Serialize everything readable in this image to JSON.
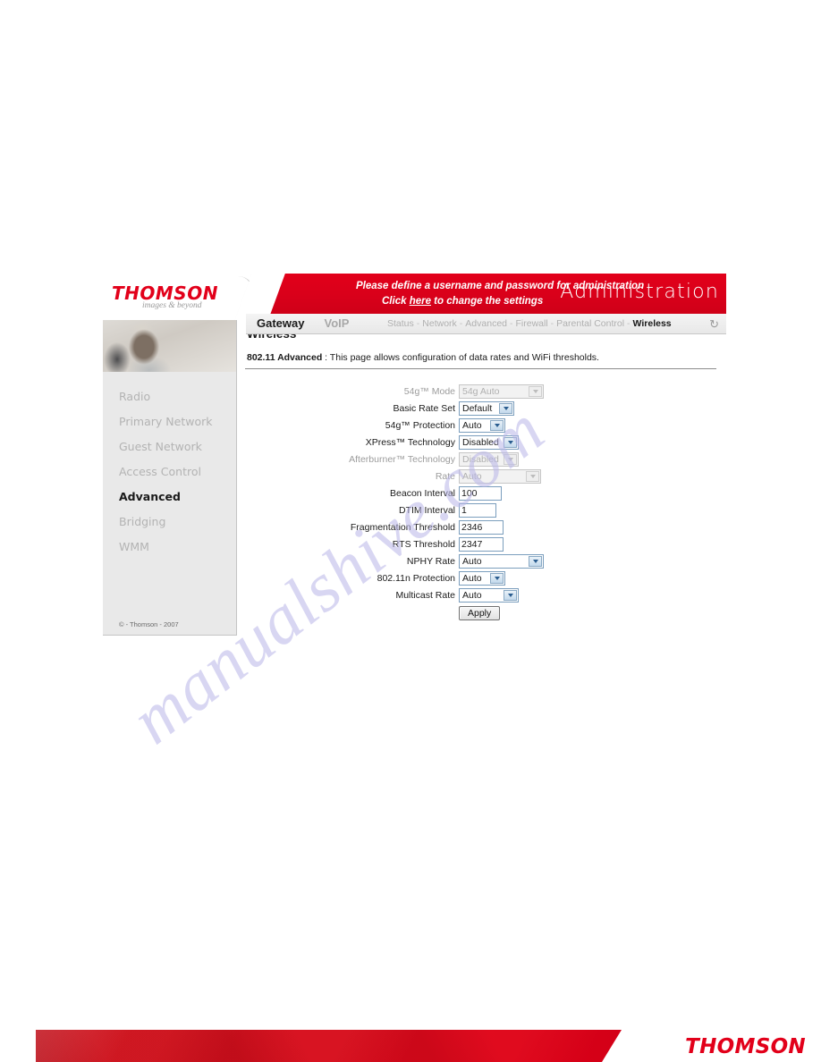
{
  "watermark": {
    "text": "manualshive.com"
  },
  "brand": {
    "logo": "THOMSON",
    "tagline": "images & beyond",
    "footer_logo": "THOMSON",
    "accent_color": "#e2001a"
  },
  "banner": {
    "line1": "Please define a username and password for administration",
    "line2_before": "Click ",
    "line2_link": "here",
    "line2_after": " to change the settings",
    "section_title": "Administration"
  },
  "nav": {
    "primary": [
      {
        "label": "Gateway",
        "active": true
      },
      {
        "label": "VoIP",
        "active": false
      }
    ],
    "secondary": [
      {
        "label": "Status",
        "active": false
      },
      {
        "label": "Network",
        "active": false
      },
      {
        "label": "Advanced",
        "active": false
      },
      {
        "label": "Firewall",
        "active": false
      },
      {
        "label": "Parental Control",
        "active": false
      },
      {
        "label": "Wireless",
        "active": true
      }
    ],
    "separator": "-",
    "refresh_icon": "↻"
  },
  "sidebar": {
    "items": [
      {
        "label": "Radio",
        "active": false
      },
      {
        "label": "Primary Network",
        "active": false
      },
      {
        "label": "Guest Network",
        "active": false
      },
      {
        "label": "Access Control",
        "active": false
      },
      {
        "label": "Advanced",
        "active": true
      },
      {
        "label": "Bridging",
        "active": false
      },
      {
        "label": "WMM",
        "active": false
      }
    ],
    "copyright": "© - Thomson - 2007"
  },
  "content": {
    "title": "Wireless",
    "subtitle_bold": "802.11 Advanced",
    "subtitle_rest": " :  This page allows configuration of data rates and WiFi thresholds."
  },
  "form": {
    "rows": [
      {
        "label": "54g™ Mode",
        "type": "select",
        "value": "54g Auto",
        "disabled": true,
        "width": "w-xwide"
      },
      {
        "label": "Basic Rate Set",
        "type": "select",
        "value": "Default",
        "disabled": false,
        "width": "w-med"
      },
      {
        "label": "54g™ Protection",
        "type": "select",
        "value": "Auto",
        "disabled": false,
        "width": "w-small"
      },
      {
        "label": "XPress™ Technology",
        "type": "select",
        "value": "Disabled",
        "disabled": false,
        "width": "w-med2"
      },
      {
        "label": "Afterburner™ Technology",
        "type": "select",
        "value": "Disabled",
        "disabled": true,
        "width": "w-med2"
      },
      {
        "label": "Rate",
        "type": "select",
        "value": "Auto",
        "disabled": true,
        "width": "w-wide"
      },
      {
        "label": "Beacon Interval",
        "type": "text",
        "value": "100",
        "disabled": false,
        "width": "w1"
      },
      {
        "label": "DTIM Interval",
        "type": "text",
        "value": "1",
        "disabled": false,
        "width": "w2"
      },
      {
        "label": "Fragmentation Threshold",
        "type": "text",
        "value": "2346",
        "disabled": false,
        "width": "w3"
      },
      {
        "label": "RTS Threshold",
        "type": "text",
        "value": "2347",
        "disabled": false,
        "width": "w3"
      },
      {
        "label": "NPHY Rate",
        "type": "select",
        "value": "Auto",
        "disabled": false,
        "width": "w-xwide"
      },
      {
        "label": "802.11n Protection",
        "type": "select",
        "value": "Auto",
        "disabled": false,
        "width": "w-small"
      },
      {
        "label": "Multicast Rate",
        "type": "select",
        "value": "Auto",
        "disabled": false,
        "width": "w-med2"
      }
    ],
    "apply_label": "Apply"
  }
}
